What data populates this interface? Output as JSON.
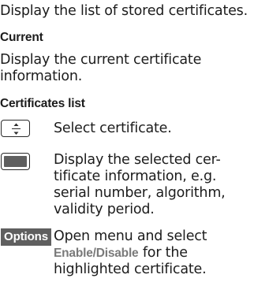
{
  "intro": {
    "text": "Display the list of stored certificates."
  },
  "current": {
    "heading": "Current",
    "description": "Display the current certificate information."
  },
  "certificates_list": {
    "heading": "Certificates list",
    "rows": [
      {
        "icon": "navigation-key-up-down-icon",
        "description": "Select certificate."
      },
      {
        "icon": "centre-softkey-icon",
        "description": "Display the selected certificate information, e.g. serial number, algorithm, validity period."
      },
      {
        "key_label": "Options",
        "description_before": "Open menu and select ",
        "enable_label": "Enable",
        "separator": "/",
        "disable_label": "Disable",
        "description_after": " for the highlighted certificate."
      }
    ]
  },
  "colors": {
    "text": "#1c1c1c",
    "key_background": "#5f5f5f",
    "key_text": "#ffffff",
    "inline_key_text": "#7a7a7a"
  }
}
